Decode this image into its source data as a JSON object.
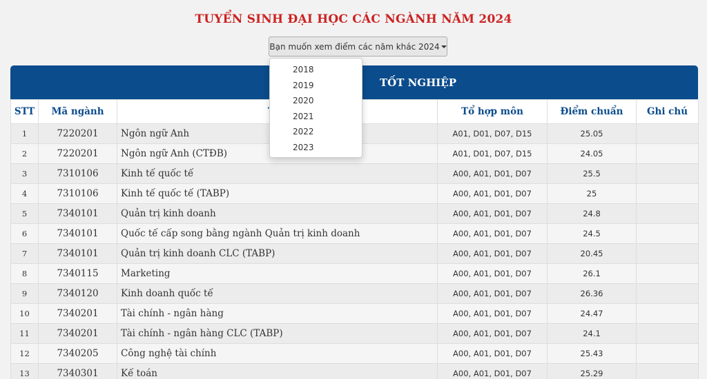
{
  "page": {
    "title": "TUYỂN SINH ĐẠI HỌC CÁC NGÀNH NĂM 2024",
    "year_button_label": "Bạn muốn xem điểm các năm khác 2024",
    "year_options": [
      "2018",
      "2019",
      "2020",
      "2021",
      "2022",
      "2023"
    ]
  },
  "table": {
    "banner_visible_text": "TỐT NGHIỆP",
    "headers": [
      "STT",
      "Mã ngành",
      "Tên",
      "Tổ hợp môn",
      "Điểm chuẩn",
      "Ghi chú"
    ],
    "rows": [
      [
        "1",
        "7220201",
        "Ngôn ngữ Anh",
        "A01, D01, D07, D15",
        "25.05",
        ""
      ],
      [
        "2",
        "7220201",
        "Ngôn ngữ Anh (CTĐB)",
        "A01, D01, D07, D15",
        "24.05",
        ""
      ],
      [
        "3",
        "7310106",
        "Kinh tế quốc tế",
        "A00, A01, D01, D07",
        "25.5",
        ""
      ],
      [
        "4",
        "7310106",
        "Kinh tế quốc tế (TABP)",
        "A00, A01, D01, D07",
        "25",
        ""
      ],
      [
        "5",
        "7340101",
        "Quản trị kinh doanh",
        "A00, A01, D01, D07",
        "24.8",
        ""
      ],
      [
        "6",
        "7340101",
        "Quốc tế cấp song bằng ngành Quản trị kinh doanh",
        "A00, A01, D01, D07",
        "24.5",
        ""
      ],
      [
        "7",
        "7340101",
        "Quản trị kinh doanh CLC (TABP)",
        "A00, A01, D01, D07",
        "20.45",
        ""
      ],
      [
        "8",
        "7340115",
        "Marketing",
        "A00, A01, D01, D07",
        "26.1",
        ""
      ],
      [
        "9",
        "7340120",
        "Kinh doanh quốc tế",
        "A00, A01, D01, D07",
        "26.36",
        ""
      ],
      [
        "10",
        "7340201",
        "Tài chính - ngân hàng",
        "A00, A01, D01, D07",
        "24.47",
        ""
      ],
      [
        "11",
        "7340201",
        "Tài chính - ngân hàng CLC (TABP)",
        "A00, A01, D01, D07",
        "24.1",
        ""
      ],
      [
        "12",
        "7340205",
        "Công nghệ tài chính",
        "A00, A01, D01, D07",
        "25.43",
        ""
      ],
      [
        "13",
        "7340301",
        "Kế toán",
        "A00, A01, D01, D07",
        "25.29",
        ""
      ]
    ]
  }
}
